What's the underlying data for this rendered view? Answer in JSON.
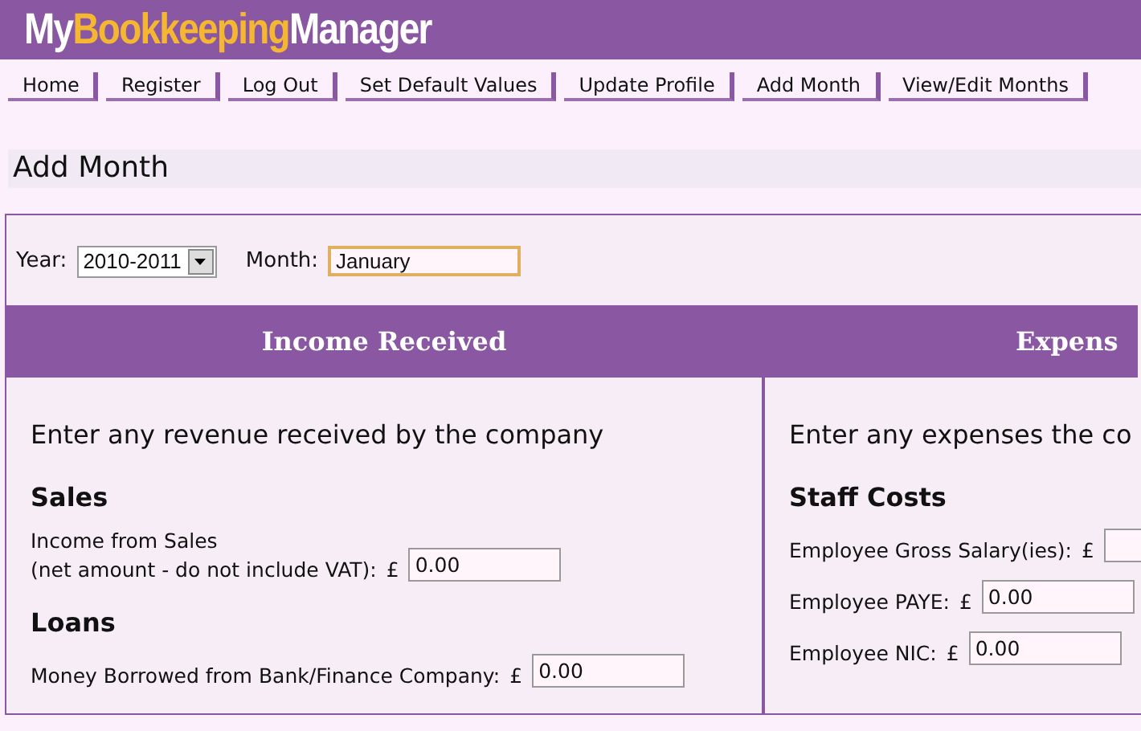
{
  "logo": {
    "parts": [
      {
        "text": "My",
        "kind": "plain"
      },
      {
        "text": "Bookkeeping",
        "kind": "accent"
      },
      {
        "text": "Manager",
        "kind": "plain"
      }
    ]
  },
  "nav": [
    {
      "label": "Home"
    },
    {
      "label": "Register"
    },
    {
      "label": "Log Out"
    },
    {
      "label": "Set Default Values"
    },
    {
      "label": "Update Profile"
    },
    {
      "label": "Add Month"
    },
    {
      "label": "View/Edit Months"
    }
  ],
  "page_title": "Add Month",
  "form": {
    "year_label": "Year:",
    "year_value": "2010-2011",
    "month_label": "Month:",
    "month_value": "January",
    "columns": [
      {
        "heading": "Income Received",
        "intro": "Enter any revenue received by the company",
        "sections": [
          {
            "title": "Sales",
            "fields": [
              {
                "label_lines": [
                  "Income from Sales",
                  "(net amount - do not include VAT):"
                ],
                "currency": "£",
                "value": "0.00"
              }
            ]
          },
          {
            "title": "Loans",
            "fields": [
              {
                "label_lines": [
                  "Money Borrowed from Bank/Finance Company:"
                ],
                "currency": "£",
                "value": "0.00"
              }
            ]
          }
        ]
      },
      {
        "heading": "Expens",
        "intro": "Enter any expenses the co",
        "sections": [
          {
            "title": "Staff Costs",
            "fields": [
              {
                "label_lines": [
                  "Employee Gross Salary(ies):"
                ],
                "currency": "£"
              },
              {
                "label_lines": [
                  "Employee PAYE:"
                ],
                "currency": "£",
                "value": "0.00"
              },
              {
                "label_lines": [
                  "Employee NIC:"
                ],
                "currency": "£",
                "value": "0.00"
              }
            ]
          }
        ]
      }
    ]
  }
}
